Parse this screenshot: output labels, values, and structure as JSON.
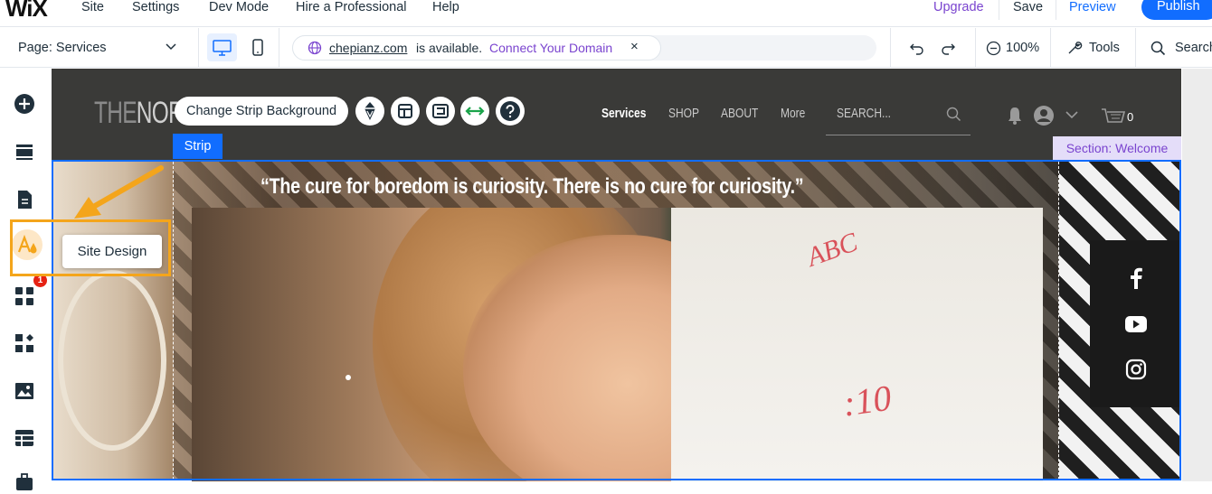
{
  "topbar": {
    "logo": "WiX",
    "menu": [
      "Site",
      "Settings",
      "Dev Mode",
      "Hire a Professional",
      "Help"
    ],
    "upgrade": "Upgrade",
    "save": "Save",
    "preview": "Preview",
    "publish": "Publish"
  },
  "secondbar": {
    "page_label": "Page: Services",
    "domain_name": "chepianz.com",
    "domain_available": "is available.",
    "domain_connect": "Connect Your Domain",
    "close": "×",
    "zoom": "100%",
    "tools": "Tools",
    "search": "Search"
  },
  "lefttoolbar": {
    "tooltip": "Site Design",
    "notification_count": "1"
  },
  "canvas": {
    "strip_tag": "Strip",
    "section_tag": "Section: Welcome",
    "change_strip_bg": "Change Strip Background",
    "site_logo_light": "THE",
    "site_logo_dark": "NOR",
    "nav": [
      "Services",
      "SHOP",
      "ABOUT",
      "More"
    ],
    "search_placeholder": "SEARCH...",
    "cart_count": "0",
    "quote": "“The cure for boredom is curiosity. There is no cure for curiosity.”"
  },
  "colors": {
    "accent_blue": "#116dff",
    "highlight_orange": "#f4a51b",
    "purple": "#7a44cf",
    "header_dark": "#3a3a38"
  }
}
